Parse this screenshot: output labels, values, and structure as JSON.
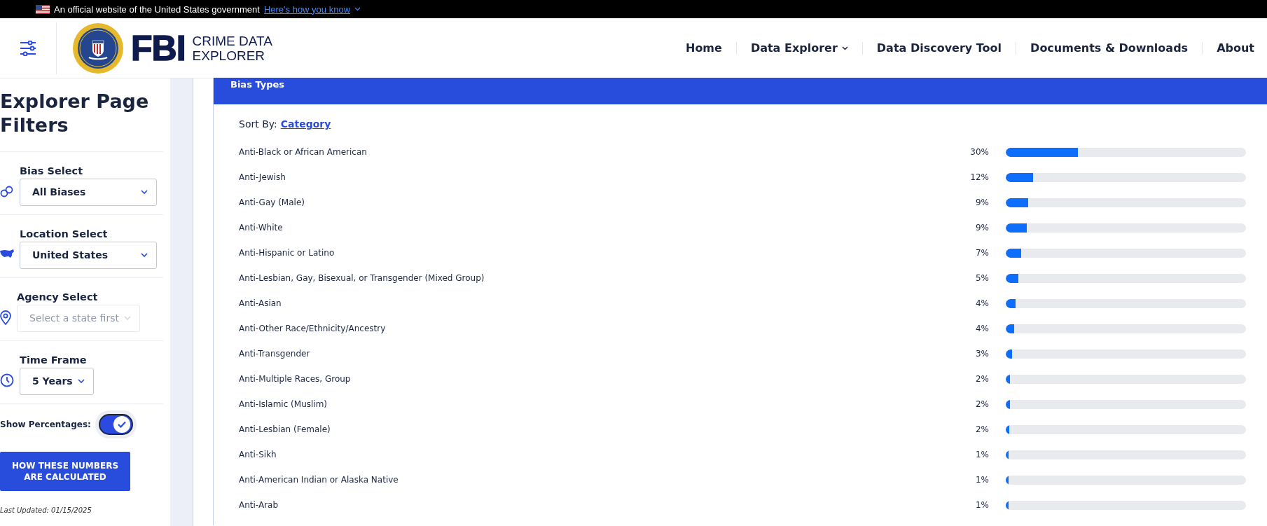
{
  "gov_banner": {
    "text": "An official website of the United States government",
    "link": "Here's how you know"
  },
  "header": {
    "logo_main": "FBI",
    "logo_sub": [
      "CRIME DATA",
      "EXPLORER"
    ],
    "nav": [
      {
        "label": "Home",
        "dropdown": false
      },
      {
        "label": "Data Explorer",
        "dropdown": true
      },
      {
        "label": "Data Discovery Tool",
        "dropdown": false
      },
      {
        "label": "Documents & Downloads",
        "dropdown": false
      },
      {
        "label": "About",
        "dropdown": false
      }
    ]
  },
  "sidebar": {
    "title": "Explorer Page Filters",
    "filters": [
      {
        "kind": "bias",
        "label": "Bias Select",
        "value": "All Biases",
        "disabled": false
      },
      {
        "kind": "location",
        "label": "Location Select",
        "value": "United States",
        "disabled": false
      },
      {
        "kind": "agency",
        "label": "Agency Select",
        "placeholder": "Select a state first",
        "disabled": true
      },
      {
        "kind": "time",
        "label": "Time Frame",
        "value": "5 Years",
        "disabled": false
      }
    ],
    "toggle": {
      "label": "Show Percentages:",
      "on": true
    },
    "button": [
      "HOW THESE NUMBERS",
      "ARE CALCULATED"
    ],
    "last_updated": "Last Updated: 01/15/2025"
  },
  "card": {
    "title": "Bias Types",
    "sort_label": "Sort By:",
    "sort_value": "Category",
    "rows": [
      {
        "label": "Anti-Black or African American",
        "pct": "30%",
        "level": 0.3
      },
      {
        "label": "Anti-Jewish",
        "pct": "12%",
        "level": 0.115
      },
      {
        "label": "Anti-Gay (Male)",
        "pct": "9%",
        "level": 0.092
      },
      {
        "label": "Anti-White",
        "pct": "9%",
        "level": 0.088
      },
      {
        "label": "Anti-Hispanic or Latino",
        "pct": "7%",
        "level": 0.065
      },
      {
        "label": "Anti-Lesbian, Gay, Bisexual, or Transgender (Mixed Group)",
        "pct": "5%",
        "level": 0.052
      },
      {
        "label": "Anti-Asian",
        "pct": "4%",
        "level": 0.04
      },
      {
        "label": "Anti-Other Race/Ethnicity/Ancestry",
        "pct": "4%",
        "level": 0.035
      },
      {
        "label": "Anti-Transgender",
        "pct": "3%",
        "level": 0.025
      },
      {
        "label": "Anti-Multiple Races, Group",
        "pct": "2%",
        "level": 0.018
      },
      {
        "label": "Anti-Islamic (Muslim)",
        "pct": "2%",
        "level": 0.017
      },
      {
        "label": "Anti-Lesbian (Female)",
        "pct": "2%",
        "level": 0.016
      },
      {
        "label": "Anti-Sikh",
        "pct": "1%",
        "level": 0.012
      },
      {
        "label": "Anti-American Indian or Alaska Native",
        "pct": "1%",
        "level": 0.012
      },
      {
        "label": "Anti-Arab",
        "pct": "1%",
        "level": 0.011
      }
    ]
  }
}
